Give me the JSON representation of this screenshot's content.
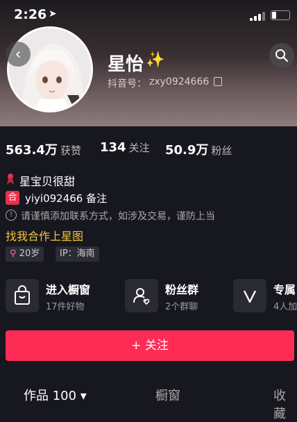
{
  "status_bar": {
    "time": "2:26"
  },
  "profile": {
    "name": "星怡",
    "name_emoji": "✨",
    "douyin_label": "抖音号：",
    "douyin_id": "zxy0924666"
  },
  "stats": [
    {
      "value": "563.4万",
      "label": "获赞"
    },
    {
      "value": "134",
      "label": "关注"
    },
    {
      "value": "50.9万",
      "label": "粉丝"
    }
  ],
  "bio": {
    "line1": "星宝贝很甜",
    "note_icon_text": "合",
    "line2": "yiyi092466 备注",
    "warning": "请谨慎添加联系方式，如涉及交易，谨防上当",
    "star_link": "找我合作上星图"
  },
  "tags": [
    {
      "text": "20岁",
      "icon": "female-icon"
    },
    {
      "text": "IP：海南"
    }
  ],
  "services": [
    {
      "title": "进入橱窗",
      "sub": "17件好物",
      "icon": "shopping-bag-icon"
    },
    {
      "title": "粉丝群",
      "sub": "2个群聊",
      "icon": "group-icon"
    },
    {
      "title": "专属",
      "sub": "4人加",
      "icon": "v-icon"
    }
  ],
  "follow_button": "+ 关注",
  "tabs": [
    {
      "label": "作品 100 ▾"
    },
    {
      "label": "橱窗"
    },
    {
      "label": "收藏"
    }
  ],
  "colors": {
    "accent": "#fe2c55",
    "background": "#17171f",
    "gold": "#f5c43a"
  }
}
